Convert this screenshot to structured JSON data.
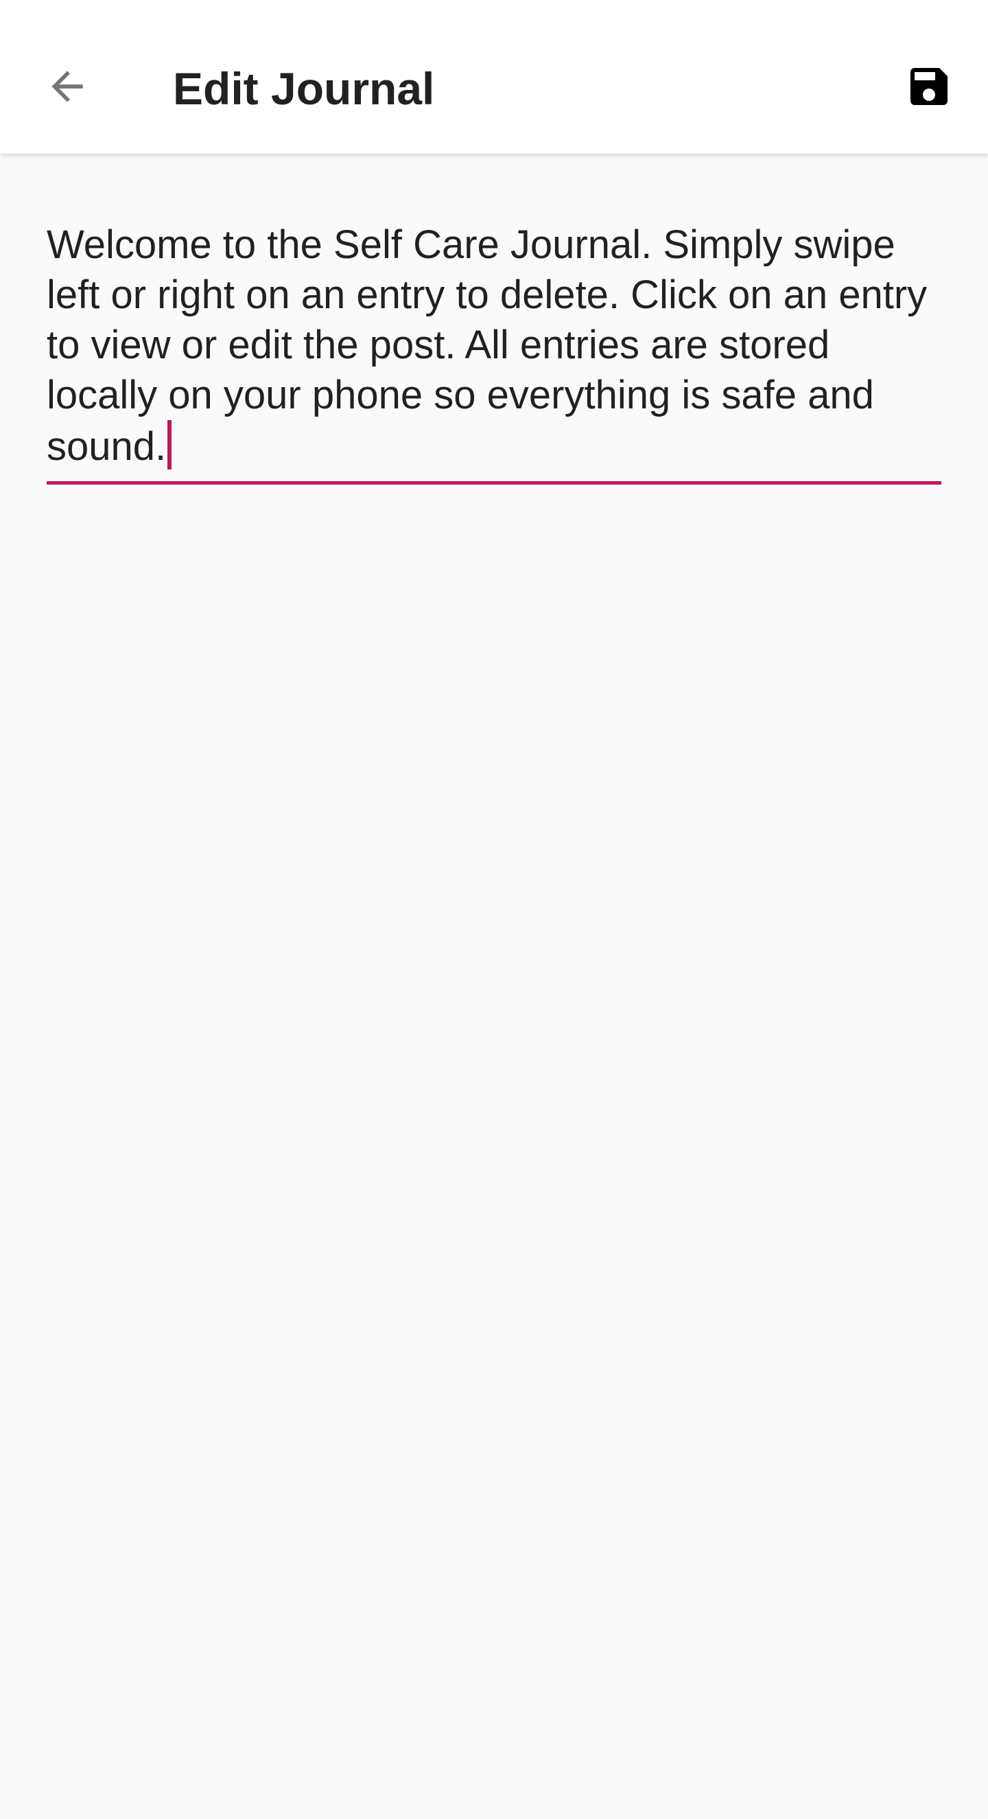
{
  "app_bar": {
    "title": "Edit Journal",
    "back_icon": "arrow-back-icon",
    "save_icon": "floppy-disk-icon"
  },
  "editor": {
    "value": "Welcome to the Self Care Journal. Simply swipe left or right on an entry to delete. Click on an entry to view or edit the post. All entries are stored locally on your phone so everything is safe and sound."
  },
  "colors": {
    "accent": "#c2185b",
    "text": "#212121",
    "background": "#fafafa",
    "app_bar": "#ffffff"
  }
}
